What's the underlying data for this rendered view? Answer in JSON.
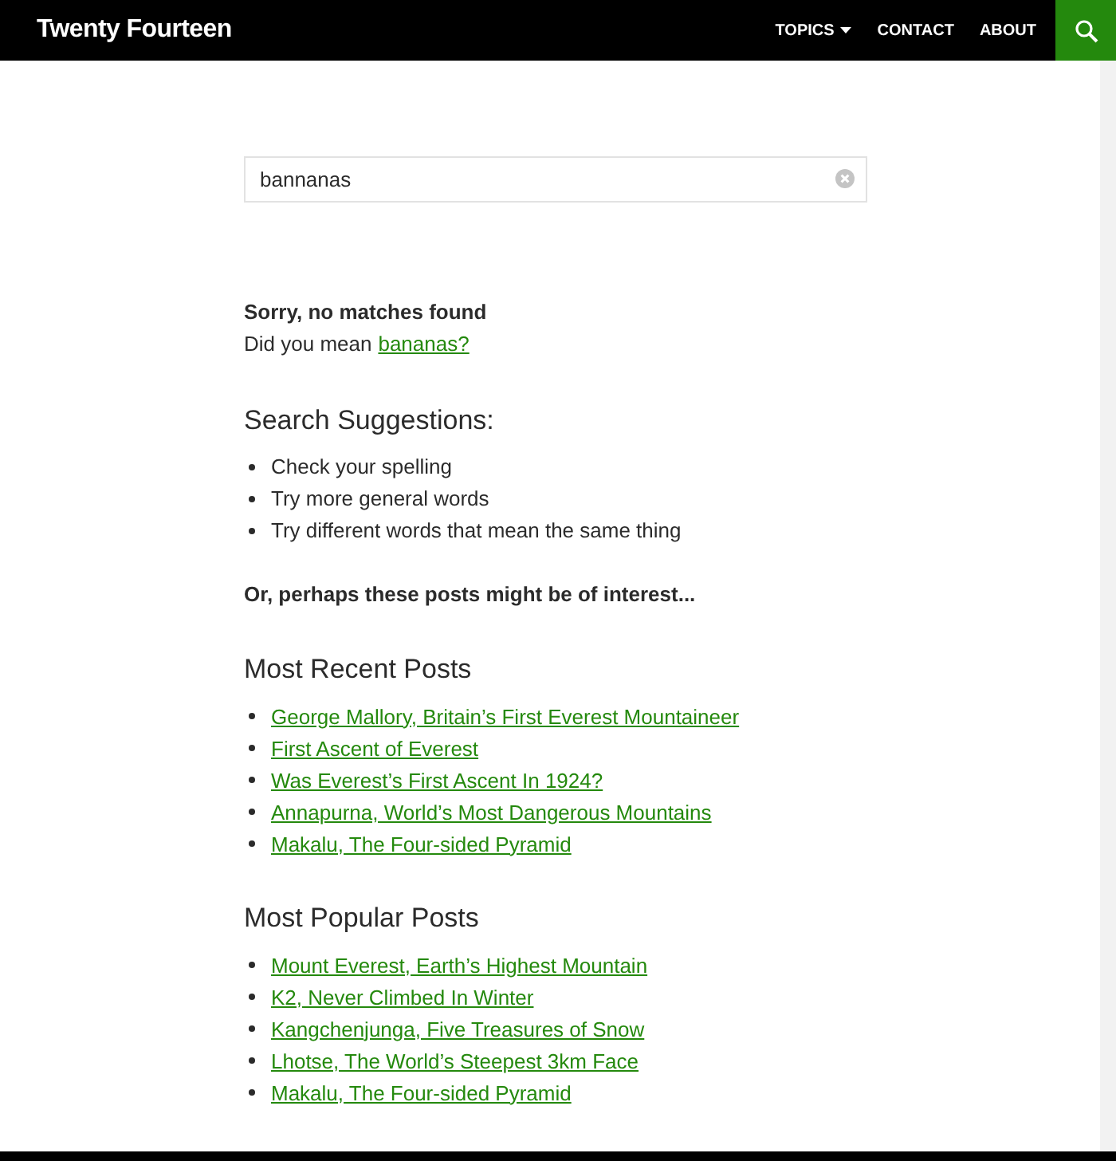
{
  "header": {
    "site_title": "Twenty Fourteen",
    "nav": [
      {
        "label": "TOPICS",
        "has_dropdown": true
      },
      {
        "label": "CONTACT",
        "has_dropdown": false
      },
      {
        "label": "ABOUT",
        "has_dropdown": false
      }
    ]
  },
  "search": {
    "value": "bannanas"
  },
  "no_results": {
    "title": "Sorry, no matches found",
    "prompt": "Did you mean",
    "suggestion": "bananas?"
  },
  "suggestions": {
    "heading": "Search Suggestions:",
    "items": [
      "Check your spelling",
      "Try more general words",
      "Try different words that mean the same thing"
    ]
  },
  "interest_note": "Or, perhaps these posts might be of interest...",
  "post_lists": [
    {
      "heading": "Most Recent Posts",
      "posts": [
        "George Mallory, Britain’s First Everest Mountaineer",
        "First Ascent of Everest",
        "Was Everest’s First Ascent In 1924?",
        "Annapurna, World’s Most Dangerous Mountains",
        "Makalu, The Four-sided Pyramid"
      ]
    },
    {
      "heading": "Most Popular Posts",
      "posts": [
        "Mount Everest, Earth’s Highest Mountain",
        "K2, Never Climbed In Winter",
        "Kangchenjunga, Five Treasures of Snow",
        "Lhotse, The World’s Steepest 3km Face",
        "Makalu, The Four-sided Pyramid"
      ]
    }
  ]
}
